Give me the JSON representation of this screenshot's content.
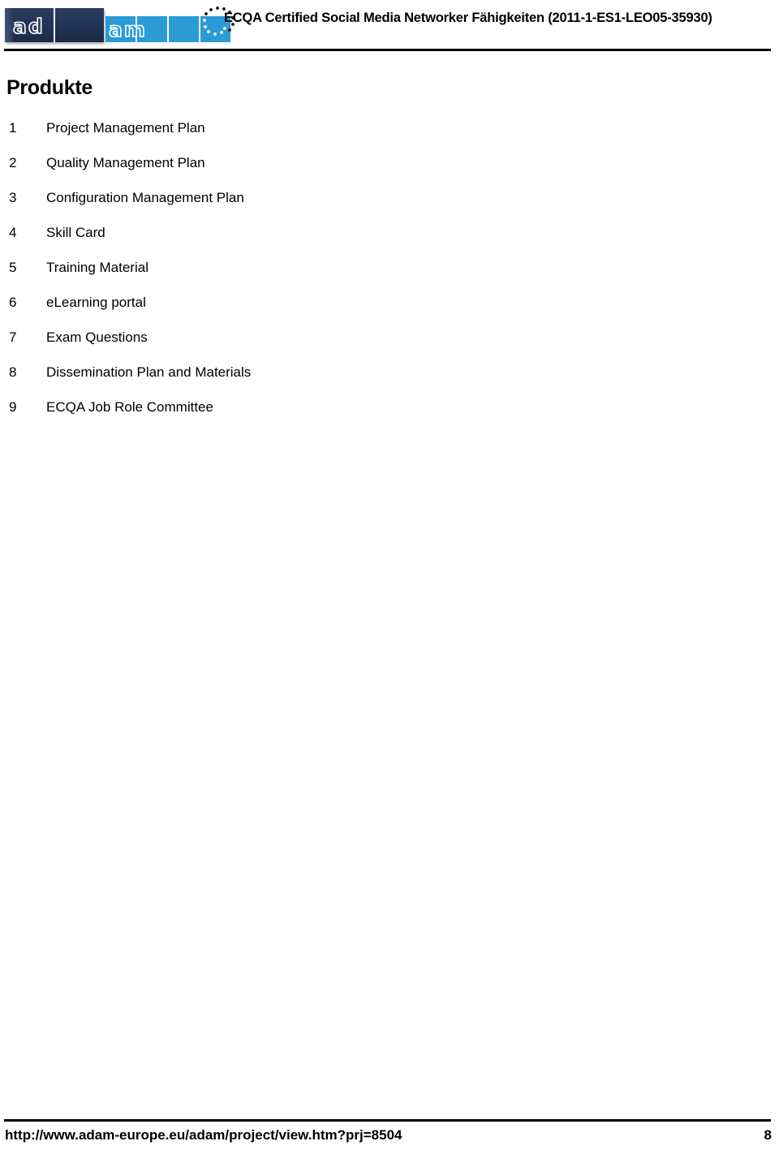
{
  "header": {
    "logo": {
      "name": "adam-logo",
      "dark_text": "ad",
      "blue_text": "am",
      "eu_flag_icon": "eu-stars-icon"
    },
    "title": "ECQA Certified Social Media Networker Fähigkeiten (2011-1-ES1-LEO05-35930)"
  },
  "main": {
    "page_title": "Produkte",
    "products": [
      {
        "num": "1",
        "label": "Project Management Plan"
      },
      {
        "num": "2",
        "label": "Quality Management Plan"
      },
      {
        "num": "3",
        "label": "Configuration Management Plan"
      },
      {
        "num": "4",
        "label": "Skill Card"
      },
      {
        "num": "5",
        "label": "Training Material"
      },
      {
        "num": "6",
        "label": "eLearning portal"
      },
      {
        "num": "7",
        "label": "Exam Questions"
      },
      {
        "num": "8",
        "label": "Dissemination Plan and Materials"
      },
      {
        "num": "9",
        "label": "ECQA Job Role Committee"
      }
    ]
  },
  "footer": {
    "url": "http://www.adam-europe.eu/adam/project/view.htm?prj=8504",
    "page_number": "8"
  },
  "colors": {
    "logo_dark_navy": "#223454",
    "logo_bright_blue": "#2a9bd4",
    "text": "#000000",
    "background": "#ffffff"
  }
}
